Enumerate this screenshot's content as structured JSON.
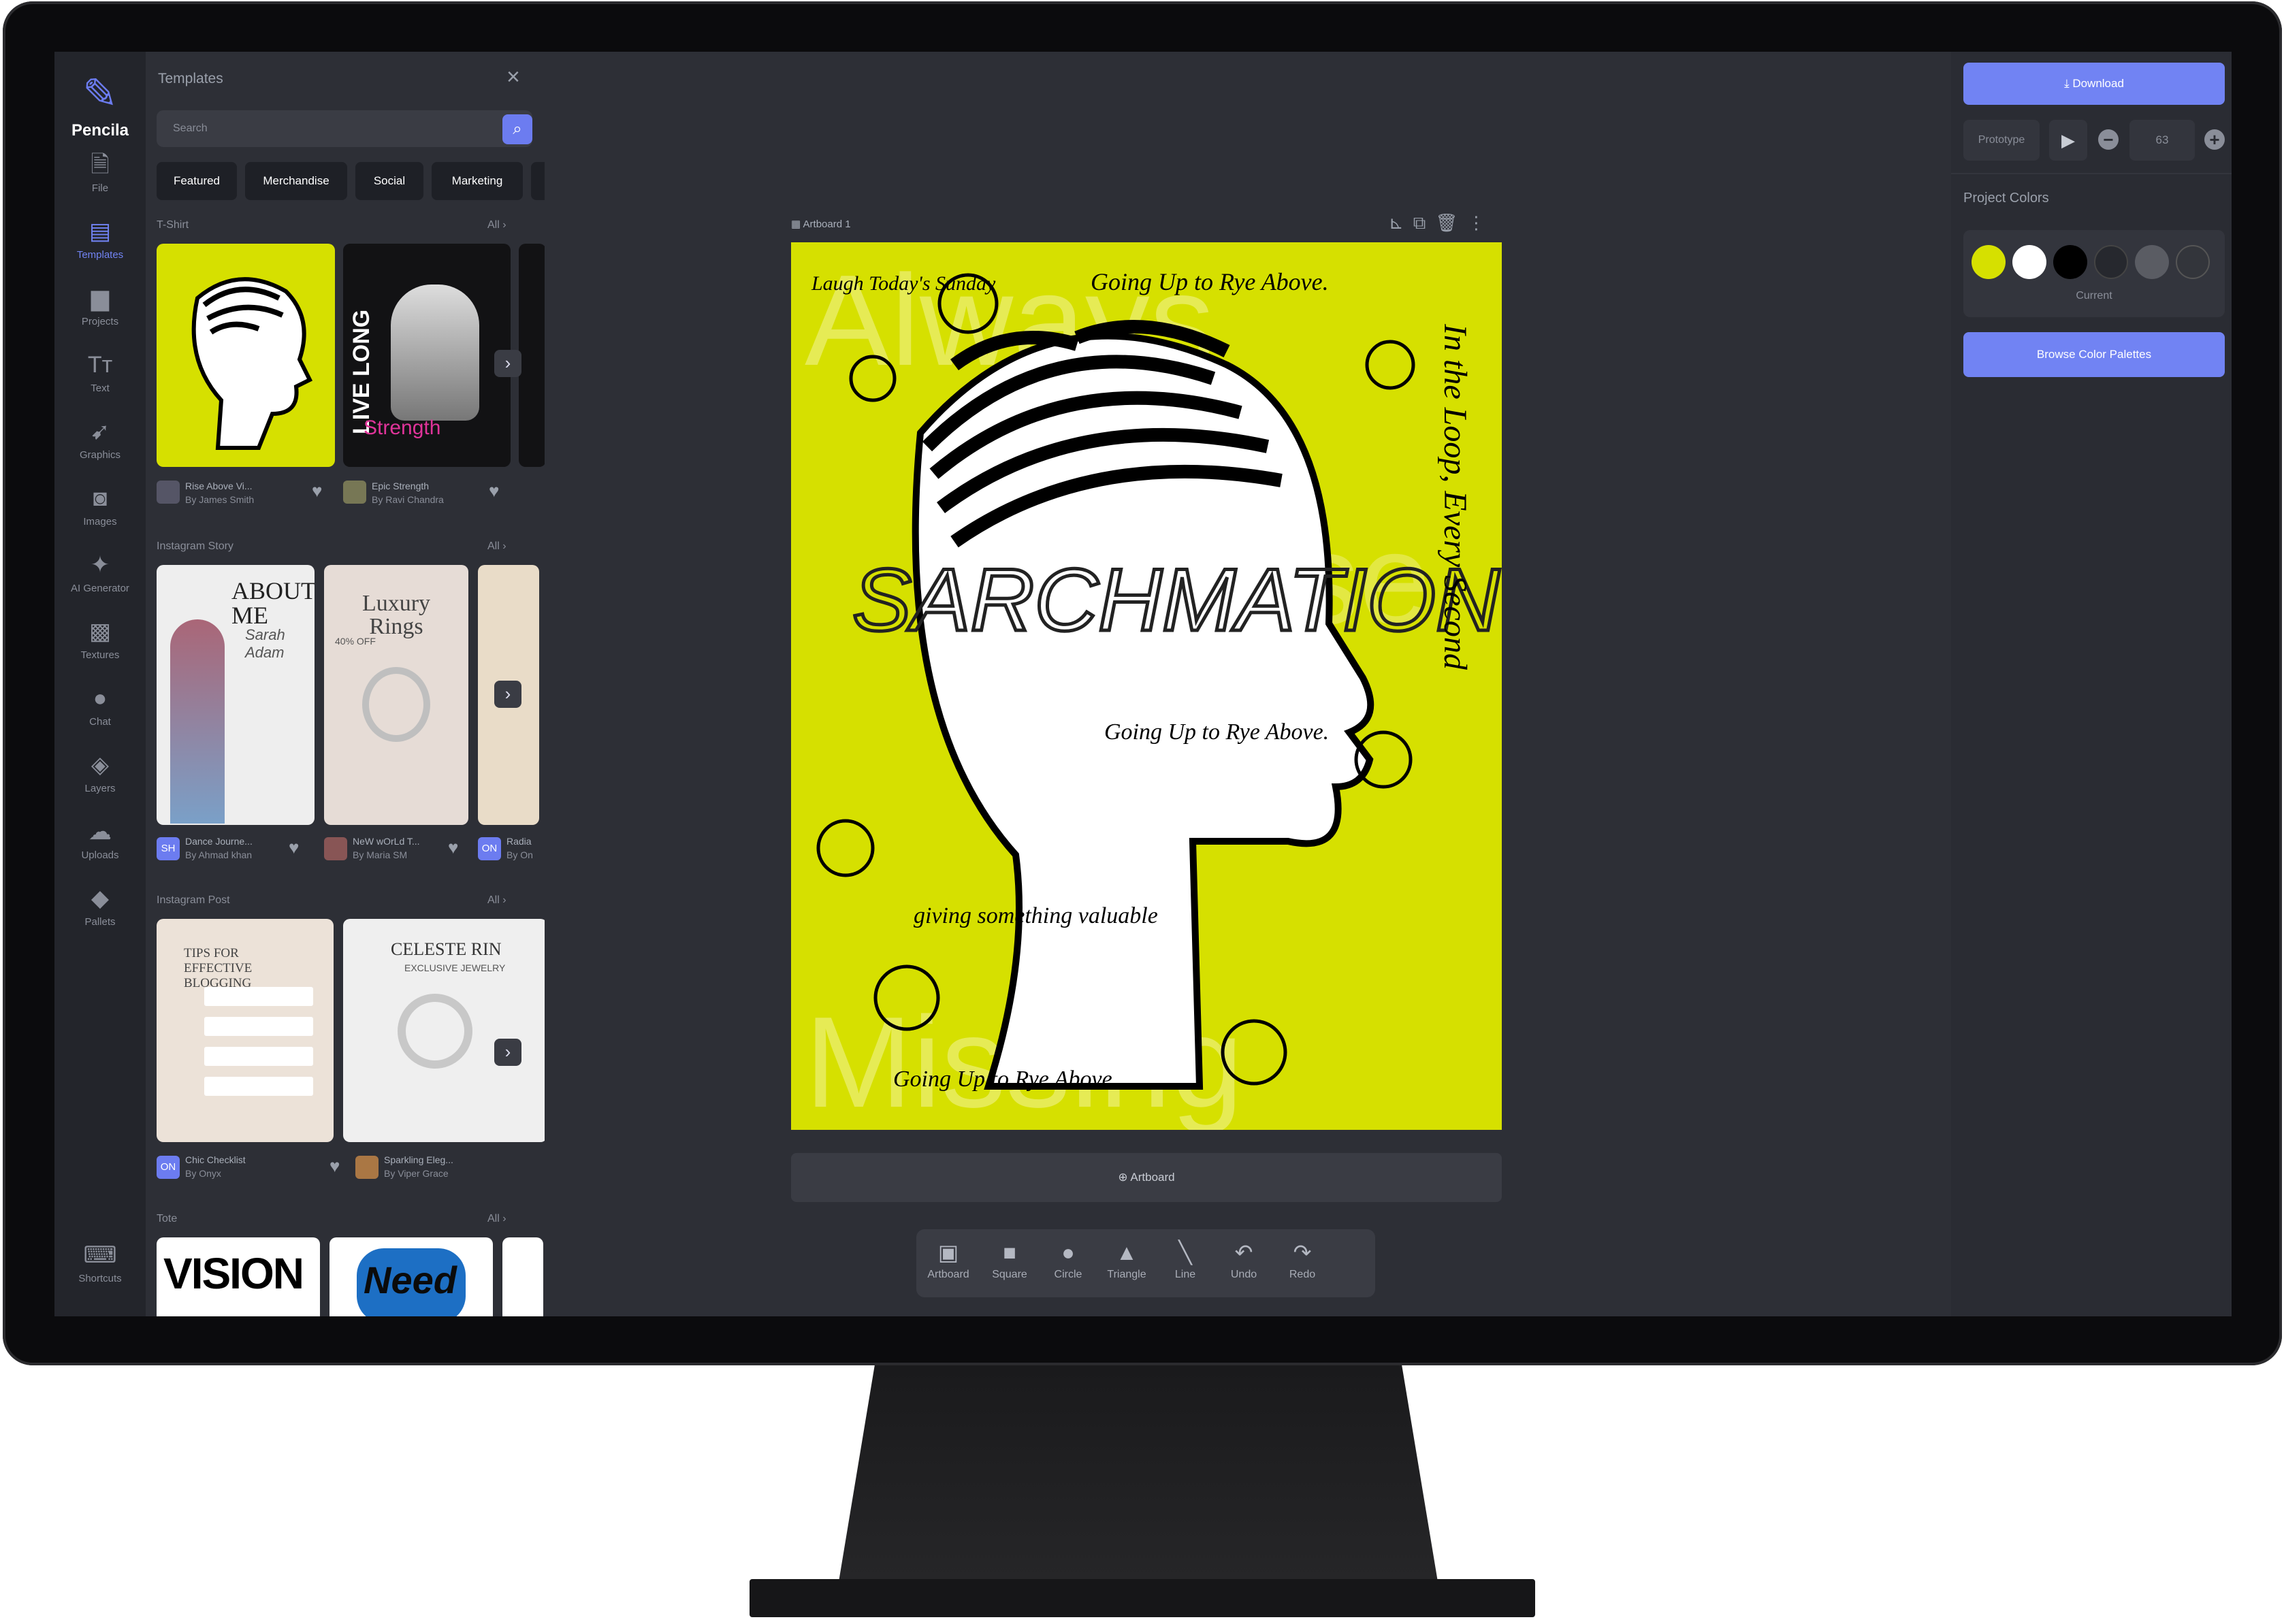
{
  "app": {
    "name": "Pencila"
  },
  "rail": [
    {
      "label": "File",
      "icon": "file-icon"
    },
    {
      "label": "Templates",
      "icon": "templates-icon"
    },
    {
      "label": "Projects",
      "icon": "folder-icon"
    },
    {
      "label": "Text",
      "icon": "text-icon"
    },
    {
      "label": "Graphics",
      "icon": "rocket-icon"
    },
    {
      "label": "Images",
      "icon": "camera-icon"
    },
    {
      "label": "AI Generator",
      "icon": "sparkle-icon"
    },
    {
      "label": "Textures",
      "icon": "texture-icon"
    },
    {
      "label": "Chat",
      "icon": "chat-icon"
    },
    {
      "label": "Layers",
      "icon": "layers-icon"
    },
    {
      "label": "Uploads",
      "icon": "upload-icon"
    },
    {
      "label": "Pallets",
      "icon": "paint-bucket-icon"
    },
    {
      "label": "Shortcuts",
      "icon": "keyboard-icon"
    }
  ],
  "panel": {
    "title": "Templates",
    "search_placeholder": "Search",
    "chips": [
      "Featured",
      "Merchandise",
      "Social",
      "Marketing"
    ],
    "all_label": "All",
    "sections": [
      {
        "title": "T-Shirt",
        "items": [
          {
            "title": "Rise Above Vi...",
            "author": "By James Smith",
            "card_title": "",
            "card_sub": ""
          },
          {
            "title": "Epic Strength",
            "author": "By Ravi Chandra",
            "card_title": "LIVE LONG",
            "card_sub": "Strength"
          }
        ]
      },
      {
        "title": "Instagram Story",
        "items": [
          {
            "title": "Dance Journe...",
            "author": "By Ahmad khan",
            "avatar": "SH",
            "card_title": "ABOUT ME",
            "card_sub": "Sarah Adam"
          },
          {
            "title": "NeW wOrLd T...",
            "author": "By Maria SM",
            "card_title": "Luxury Rings",
            "card_sub": "40% OFF"
          },
          {
            "title": "Radia",
            "author": "By On",
            "avatar": "ON"
          }
        ]
      },
      {
        "title": "Instagram Post",
        "items": [
          {
            "title": "Chic Checklist",
            "author": "By Onyx",
            "avatar": "ON",
            "card_title": "TIPS FOR EFFECTIVE BLOGGING"
          },
          {
            "title": "Sparkling Eleg...",
            "author": "By Viper Grace",
            "card_title": "CELESTE RIN",
            "card_sub": "EXCLUSIVE JEWELRY"
          }
        ]
      },
      {
        "title": "Tote",
        "items": [
          {
            "card_title": "VISION"
          },
          {
            "card_title": "Need"
          }
        ]
      }
    ]
  },
  "artboard": {
    "label": "Artboard 1",
    "headline": "SARCHMATION",
    "script_lines": [
      "Going Up to Rye Above.",
      "Going Up to Rye Above.",
      "giving something valuable",
      "In the Loop, Every Second",
      "Laugh Today's Sunday"
    ],
    "ghost_text": [
      "Always",
      "Missing",
      "Rise"
    ],
    "add_label": "Artboard"
  },
  "toolbar": [
    {
      "label": "Artboard",
      "icon": "artboard-icon"
    },
    {
      "label": "Square",
      "icon": "square-icon"
    },
    {
      "label": "Circle",
      "icon": "circle-icon"
    },
    {
      "label": "Triangle",
      "icon": "triangle-icon"
    },
    {
      "label": "Line",
      "icon": "line-icon"
    },
    {
      "label": "Undo",
      "icon": "undo-icon"
    },
    {
      "label": "Redo",
      "icon": "redo-icon"
    }
  ],
  "right": {
    "download": "Download",
    "prototype": "Prototype",
    "zoom": "63",
    "project_colors": "Project Colors",
    "current": "Current",
    "browse": "Browse Color Palettes",
    "swatches": [
      "#d6e000",
      "#ffffff",
      "#000000",
      "#26282e",
      "#5a5c63",
      "#33353b"
    ]
  }
}
